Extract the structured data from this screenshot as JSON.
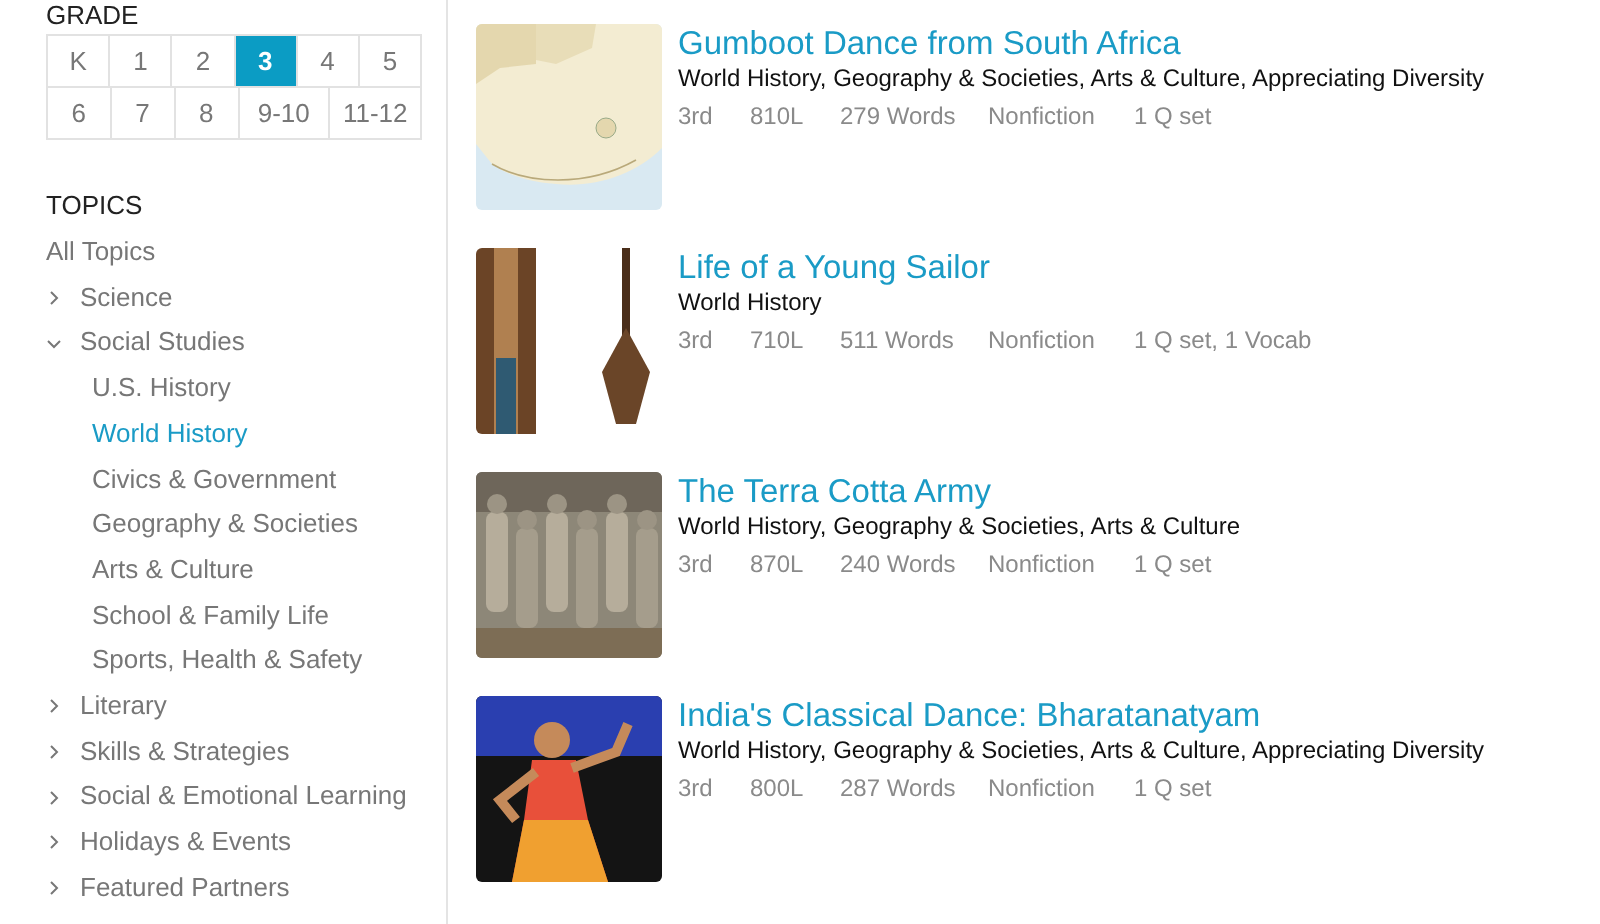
{
  "grade": {
    "heading": "GRADE",
    "options": [
      {
        "label": "K",
        "selected": false
      },
      {
        "label": "1",
        "selected": false
      },
      {
        "label": "2",
        "selected": false
      },
      {
        "label": "3",
        "selected": true
      },
      {
        "label": "4",
        "selected": false
      },
      {
        "label": "5",
        "selected": false
      },
      {
        "label": "6",
        "selected": false
      },
      {
        "label": "7",
        "selected": false
      },
      {
        "label": "8",
        "selected": false
      },
      {
        "label": "9-10",
        "selected": false
      },
      {
        "label": "11-12",
        "selected": false
      }
    ]
  },
  "topics": {
    "heading": "TOPICS",
    "all": "All Topics",
    "items": [
      {
        "label": "Science",
        "expanded": false
      },
      {
        "label": "Social Studies",
        "expanded": true,
        "children": [
          {
            "label": "U.S. History",
            "selected": false
          },
          {
            "label": "World History",
            "selected": true
          },
          {
            "label": "Civics & Government",
            "selected": false
          },
          {
            "label": "Geography & Societies",
            "selected": false
          },
          {
            "label": "Arts & Culture",
            "selected": false
          },
          {
            "label": "School & Family Life",
            "selected": false
          },
          {
            "label": "Sports, Health & Safety",
            "selected": false
          }
        ]
      },
      {
        "label": "Literary",
        "expanded": false
      },
      {
        "label": "Skills & Strategies",
        "expanded": false
      },
      {
        "label": "Social & Emotional Learning",
        "expanded": false
      },
      {
        "label": "Holidays & Events",
        "expanded": false
      },
      {
        "label": "Featured Partners",
        "expanded": false
      }
    ]
  },
  "articles": [
    {
      "title": "Gumboot Dance from South Africa",
      "image": {
        "kind": "map"
      },
      "topics": "World History, Geography & Societies, Arts & Culture, Appreciating Diversity",
      "grade": "3rd",
      "lexile": "810L",
      "words": "279 Words",
      "genre": "Nonfiction",
      "extras": "1 Q set"
    },
    {
      "title": "Life of a Young Sailor",
      "image": {
        "kind": "objects"
      },
      "topics": "World History",
      "grade": "3rd",
      "lexile": "710L",
      "words": "511 Words",
      "genre": "Nonfiction",
      "extras": "1 Q set, 1 Vocab"
    },
    {
      "title": "The Terra Cotta Army",
      "image": {
        "kind": "statues"
      },
      "topics": "World History, Geography & Societies, Arts & Culture",
      "grade": "3rd",
      "lexile": "870L",
      "words": "240 Words",
      "genre": "Nonfiction",
      "extras": "1 Q set"
    },
    {
      "title": "India's Classical Dance: Bharatanatyam",
      "image": {
        "kind": "dancer"
      },
      "topics": "World History, Geography & Societies, Arts & Culture, Appreciating Diversity",
      "grade": "3rd",
      "lexile": "800L",
      "words": "287 Words",
      "genre": "Nonfiction",
      "extras": "1 Q set"
    }
  ]
}
